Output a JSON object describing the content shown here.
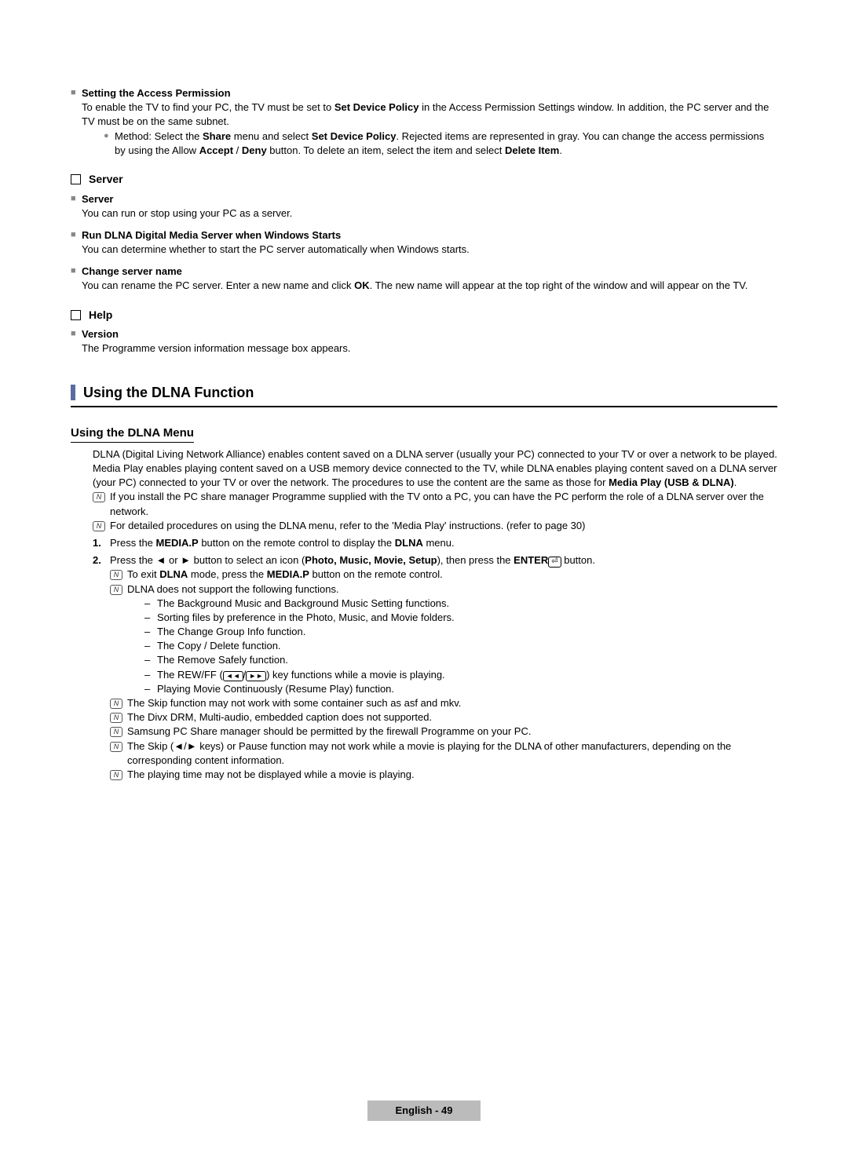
{
  "s1": {
    "title": "Setting the Access Permission",
    "p1a": "To enable the TV to find your PC, the TV must be set to ",
    "p1b": "Set Device Policy",
    "p1c": " in the Access Permission Settings window. In addition, the PC server and the TV must be on the same subnet.",
    "m1a": "Method: Select the ",
    "m1b": "Share",
    "m1c": " menu and select ",
    "m1d": "Set Device Policy",
    "m1e": ". Rejected items are represented in gray. You can change the access permissions by using the Allow ",
    "m1f": "Accept",
    "m1g": " / ",
    "m1h": "Deny",
    "m1i": " button. To delete an item, select the item and select ",
    "m1j": "Delete Item",
    "m1k": "."
  },
  "server": {
    "header": "Server",
    "t1": "Server",
    "d1": "You can run or stop using your PC as a server.",
    "t2": "Run DLNA Digital Media Server when Windows Starts",
    "d2": "You can determine whether to start the PC server automatically when Windows starts.",
    "t3": "Change server name",
    "d3a": "You can rename the PC server. Enter a new name and click ",
    "d3b": "OK",
    "d3c": ". The new name will appear at the top right of the window and will appear on the TV."
  },
  "help": {
    "header": "Help",
    "t1": "Version",
    "d1": "The Programme version information message box appears."
  },
  "chapter": "Using the DLNA Function",
  "subhead": "Using the DLNA Menu",
  "intro_a": "DLNA (Digital Living Network Alliance) enables content saved on a DLNA server (usually your PC) connected to your TV or over a network to be played. Media Play enables playing content saved on a USB memory device connected to the TV, while DLNA enables playing content saved on a DLNA server (your PC) connected to your TV or over the network. The procedures to use the content are the same as those for ",
  "intro_b": "Media Play (USB & DLNA)",
  "intro_c": ".",
  "n1": "If you install the PC share manager Programme supplied with the TV onto a PC, you can have the PC perform the role of a DLNA server over the network.",
  "n2": "For detailed procedures on using the DLNA menu, refer to the 'Media Play' instructions. (refer to page 30)",
  "step1a": "Press the ",
  "step1b": "MEDIA.P",
  "step1c": " button on the remote control to display the ",
  "step1d": "DLNA",
  "step1e": " menu.",
  "step2a": "Press the ◄ or ► button to select an icon (",
  "step2b": "Photo, Music, Movie, Setup",
  "step2c": "), then press the ",
  "step2d": "ENTER",
  "step2e": " button.",
  "sn1a": "To exit ",
  "sn1b": "DLNA",
  "sn1c": " mode, press the ",
  "sn1d": "MEDIA.P",
  "sn1e": " button on the remote control.",
  "sn2": "DLNA does not support the following functions.",
  "d_a": "The Background Music and Background Music Setting functions.",
  "d_b": "Sorting files by preference in the Photo, Music, and Movie folders.",
  "d_c": "The Change Group Info function.",
  "d_d": "The Copy / Delete function.",
  "d_e": "The Remove Safely function.",
  "d_f_a": "The REW/FF (",
  "d_f_b": ") key functions while a movie is playing.",
  "d_g": "Playing Movie Continuously (Resume Play) function.",
  "bn1": "The Skip function may not work with some container such as asf and mkv.",
  "bn2": "The Divx DRM, Multi-audio, embedded caption does not supported.",
  "bn3": "Samsung PC Share manager should be permitted by the firewall Programme on your PC.",
  "bn4": "The Skip (◄/► keys) or Pause function may not work while a movie is playing for the DLNA of other manufacturers, depending on the corresponding content information.",
  "bn5": "The playing time may not be displayed while a movie is playing.",
  "footer": "English - 49"
}
